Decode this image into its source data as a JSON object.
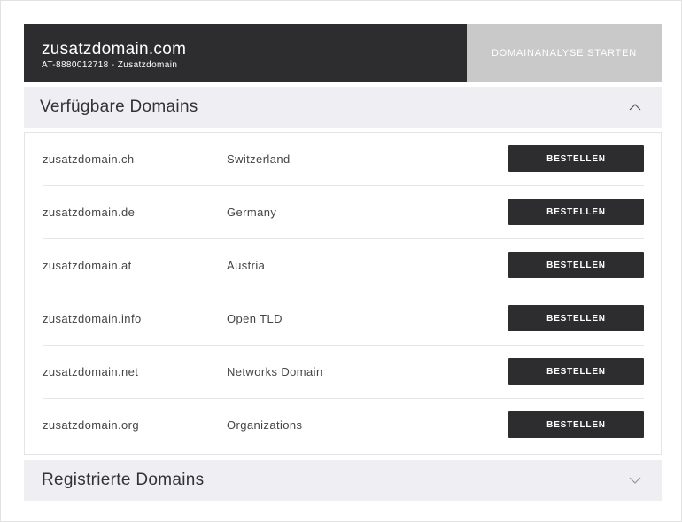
{
  "header": {
    "domain": "zusatzdomain.com",
    "subtitle": "AT-8880012718 - Zusatzdomain",
    "analyse_button": "DOMAINANALYSE STARTEN"
  },
  "available": {
    "title": "Verfügbare Domains",
    "expanded": true,
    "rows": [
      {
        "domain": "zusatzdomain.ch",
        "region": "Switzerland",
        "button": "BESTELLEN"
      },
      {
        "domain": "zusatzdomain.de",
        "region": "Germany",
        "button": "BESTELLEN"
      },
      {
        "domain": "zusatzdomain.at",
        "region": "Austria",
        "button": "BESTELLEN"
      },
      {
        "domain": "zusatzdomain.info",
        "region": "Open TLD",
        "button": "BESTELLEN"
      },
      {
        "domain": "zusatzdomain.net",
        "region": "Networks Domain",
        "button": "BESTELLEN"
      },
      {
        "domain": "zusatzdomain.org",
        "region": "Organizations",
        "button": "BESTELLEN"
      }
    ]
  },
  "registered": {
    "title": "Registrierte Domains",
    "expanded": false
  },
  "colors": {
    "dark": "#2d2d30",
    "analyse_bg": "#c9c9c9",
    "accordion_bg": "#efeff3"
  }
}
